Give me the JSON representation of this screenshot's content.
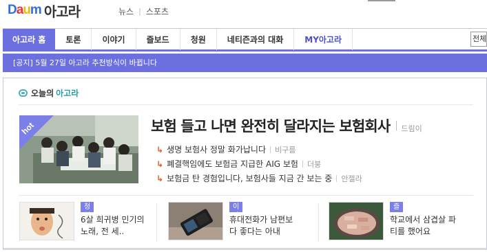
{
  "header": {
    "logo_letters": [
      "D",
      "a",
      "u",
      "m"
    ],
    "site_name": "아고라",
    "links": [
      "뉴스",
      "스포츠"
    ]
  },
  "nav": {
    "tabs": [
      "아고라 홈",
      "토론",
      "이야기",
      "즐보드",
      "청원",
      "네티즌과의 대화",
      "MY아고라"
    ],
    "active_index": 0,
    "search_value": "전체"
  },
  "notice": {
    "text": "[공지] 5월 27일 아고라 추천방식이 바뀝니다"
  },
  "today": {
    "prefix": "오늘의",
    "highlight": "아고라"
  },
  "feature": {
    "badge": "hot",
    "headline": "보험 들고 나면 완전히 달라지는 보험회사",
    "author": "드림이",
    "related": [
      {
        "text": "생명 보험사 정말 화가납니다",
        "author": "비구름"
      },
      {
        "text": "폐결핵임에도 보험금 지급한 AIG 보험",
        "author": "더붕"
      },
      {
        "text": "보험금 탄 경험입니다, 보험사들 지금 간 보는 중",
        "author": "안젤라"
      }
    ]
  },
  "cards": [
    {
      "category": "청원",
      "text": "6살 희귀병 민기의 노래, 전 세.."
    },
    {
      "category": "이야기",
      "text": "휴대전화가 남편보다 좋다는 아내"
    },
    {
      "category": "즐보드",
      "text": "학교에서 삼겹살 파티를 했어요"
    }
  ],
  "colors": {
    "accent": "#6b6fe0",
    "today_highlight": "#2b9aa5",
    "arrow": "#e05a2b"
  }
}
